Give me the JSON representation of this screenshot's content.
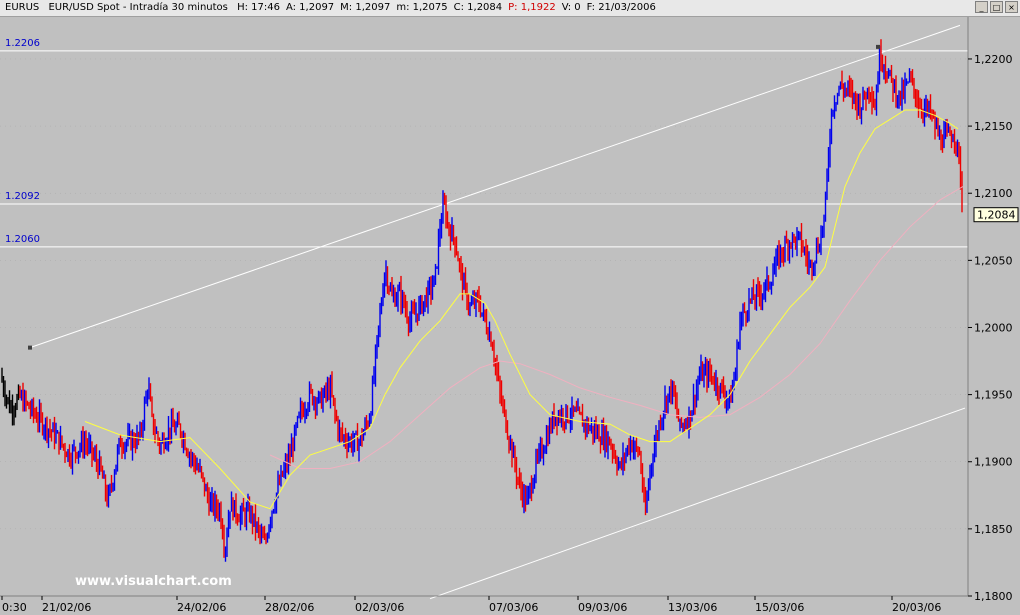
{
  "titlebar": {
    "symbol": "EURUS",
    "instrument": "EUR/USD Spot - Intradía 30 minutos",
    "stats": [
      {
        "label": "H:",
        "value": "17:46",
        "accent": false
      },
      {
        "label": "A:",
        "value": "1,2097",
        "accent": false
      },
      {
        "label": "M:",
        "value": "1,2097",
        "accent": false
      },
      {
        "label": "m:",
        "value": "1,2075",
        "accent": false
      },
      {
        "label": "C:",
        "value": "1,2084",
        "accent": false
      },
      {
        "label": "P:",
        "value": "1,1922",
        "accent": true
      },
      {
        "label": "V:",
        "value": "0",
        "accent": false
      },
      {
        "label": "F:",
        "value": "21/03/2006",
        "accent": false
      }
    ],
    "window_buttons": [
      "_",
      "□",
      "×"
    ]
  },
  "watermark": "www.visualchart.com",
  "chart_data": {
    "type": "line",
    "x_tick_labels": [
      "0:30",
      "21/02/06",
      "24/02/06",
      "28/02/06",
      "02/03/06",
      "07/03/06",
      "09/03/06",
      "13/03/06",
      "15/03/06",
      "20/03/06"
    ],
    "y_ticks": [
      1.18,
      1.185,
      1.19,
      1.195,
      1.2,
      1.205,
      1.21,
      1.215,
      1.22
    ],
    "y_tick_labels": [
      "1,1800",
      "1,1850",
      "1,1900",
      "1,1950",
      "1,2000",
      "1,2050",
      "1,2100",
      "1,2150",
      "1,2200"
    ],
    "ylim": [
      1.18,
      1.2232
    ],
    "last_price_label": "1,2084",
    "last_price": 1.2084,
    "horizontal_lines": [
      {
        "value": 1.2206,
        "label": "1.2206"
      },
      {
        "value": 1.2092,
        "label": "1.2092"
      },
      {
        "value": 1.206,
        "label": "1.2060"
      }
    ],
    "colors": {
      "background": "#c0c0c0",
      "bar_up": "#0000ee",
      "bar_down": "#ee0000",
      "ma_fast": "#ffff40",
      "ma_slow": "#f0b0c0",
      "trend_lines": "#ffffff",
      "grid": "#a8a8a8",
      "hline_label": "#0000cc"
    },
    "price_series": {
      "name": "",
      "x": [
        0,
        10,
        20,
        35,
        55,
        70,
        85,
        100,
        108,
        120,
        130,
        140,
        148,
        152,
        160,
        170,
        180,
        190,
        200,
        210,
        220,
        225,
        230,
        240,
        250,
        260,
        265,
        270,
        280,
        290,
        300,
        310,
        320,
        330,
        335,
        340,
        350,
        360,
        370,
        378,
        385,
        392,
        400,
        410,
        420,
        428,
        435,
        440,
        444,
        448,
        455,
        462,
        470,
        478,
        485,
        492,
        500,
        510,
        520,
        527,
        535,
        545,
        555,
        565,
        575,
        590,
        600,
        610,
        620,
        630,
        640,
        645,
        650,
        658,
        665,
        672,
        680,
        690,
        700,
        710,
        720,
        730,
        735,
        740,
        750,
        760,
        770,
        780,
        790,
        800,
        810,
        815,
        820,
        825,
        828,
        832,
        840,
        850,
        860,
        870,
        875,
        880,
        890,
        900,
        910,
        920,
        930,
        940,
        948,
        955,
        960,
        963
      ],
      "y": [
        1.1965,
        1.194,
        1.1948,
        1.1935,
        1.192,
        1.1905,
        1.1915,
        1.1895,
        1.187,
        1.1915,
        1.1915,
        1.1918,
        1.1958,
        1.193,
        1.1912,
        1.1925,
        1.1925,
        1.1905,
        1.1892,
        1.1868,
        1.1865,
        1.1835,
        1.1868,
        1.186,
        1.1862,
        1.1845,
        1.1838,
        1.186,
        1.1885,
        1.1905,
        1.1935,
        1.195,
        1.1945,
        1.1955,
        1.1935,
        1.192,
        1.1915,
        1.1915,
        1.1935,
        1.1995,
        1.2045,
        1.2022,
        1.2025,
        1.2005,
        1.2015,
        1.2025,
        1.2035,
        1.2075,
        1.2092,
        1.2075,
        1.2065,
        1.2035,
        1.2015,
        1.202,
        1.2005,
        1.199,
        1.195,
        1.1915,
        1.188,
        1.187,
        1.1895,
        1.1915,
        1.1935,
        1.1935,
        1.1935,
        1.1925,
        1.192,
        1.1915,
        1.1895,
        1.1915,
        1.1905,
        1.1858,
        1.1895,
        1.1925,
        1.1945,
        1.1955,
        1.1925,
        1.1935,
        1.1965,
        1.1965,
        1.1955,
        1.1945,
        1.1965,
        1.2005,
        1.202,
        1.2025,
        1.2035,
        1.2055,
        1.2065,
        1.2065,
        1.2045,
        1.2055,
        1.2065,
        1.2085,
        1.2125,
        1.2165,
        1.218,
        1.2175,
        1.2165,
        1.218,
        1.2165,
        1.2205,
        1.2185,
        1.217,
        1.2185,
        1.2165,
        1.216,
        1.214,
        1.2142,
        1.2145,
        1.2118,
        1.2084
      ]
    },
    "ma_fast": {
      "name": "",
      "x": [
        85,
        120,
        160,
        190,
        220,
        250,
        270,
        290,
        310,
        330,
        350,
        370,
        385,
        400,
        420,
        440,
        460,
        470,
        485,
        495,
        510,
        530,
        550,
        580,
        610,
        630,
        650,
        670,
        690,
        710,
        730,
        750,
        770,
        790,
        810,
        825,
        835,
        845,
        860,
        875,
        890,
        905,
        920,
        935,
        950,
        958
      ],
      "y": [
        1.193,
        1.192,
        1.1915,
        1.1918,
        1.1895,
        1.187,
        1.1865,
        1.189,
        1.1905,
        1.191,
        1.1915,
        1.1925,
        1.195,
        1.197,
        1.199,
        1.2005,
        1.2025,
        1.2025,
        1.2018,
        1.2005,
        1.198,
        1.195,
        1.1935,
        1.193,
        1.1928,
        1.192,
        1.1915,
        1.1915,
        1.1925,
        1.1935,
        1.195,
        1.1975,
        1.1995,
        1.2015,
        1.203,
        1.2045,
        1.2075,
        1.2105,
        1.213,
        1.2148,
        1.2155,
        1.2162,
        1.2162,
        1.2158,
        1.2152,
        1.2148
      ]
    },
    "ma_slow": {
      "name": "",
      "x": [
        270,
        300,
        330,
        360,
        390,
        420,
        450,
        480,
        500,
        520,
        550,
        580,
        610,
        640,
        670,
        700,
        730,
        760,
        790,
        820,
        850,
        880,
        910,
        940,
        963
      ],
      "y": [
        1.1905,
        1.1895,
        1.1895,
        1.19,
        1.1915,
        1.1935,
        1.1955,
        1.197,
        1.1975,
        1.1973,
        1.1965,
        1.1955,
        1.1948,
        1.1942,
        1.1935,
        1.1933,
        1.1935,
        1.1948,
        1.1965,
        1.1988,
        1.202,
        1.205,
        1.2075,
        1.2095,
        1.2105
      ]
    },
    "trend_lines": [
      {
        "from": [
          30,
          1.1985
        ],
        "to": [
          960,
          1.2225
        ],
        "endpoint_markers": true
      },
      {
        "from": [
          430,
          1.1798
        ],
        "to": [
          965,
          1.194
        ],
        "endpoint_markers": false
      }
    ],
    "marker_points": [
      {
        "x": 878,
        "y": 1.2209
      }
    ],
    "grid": false,
    "legend": "none"
  }
}
